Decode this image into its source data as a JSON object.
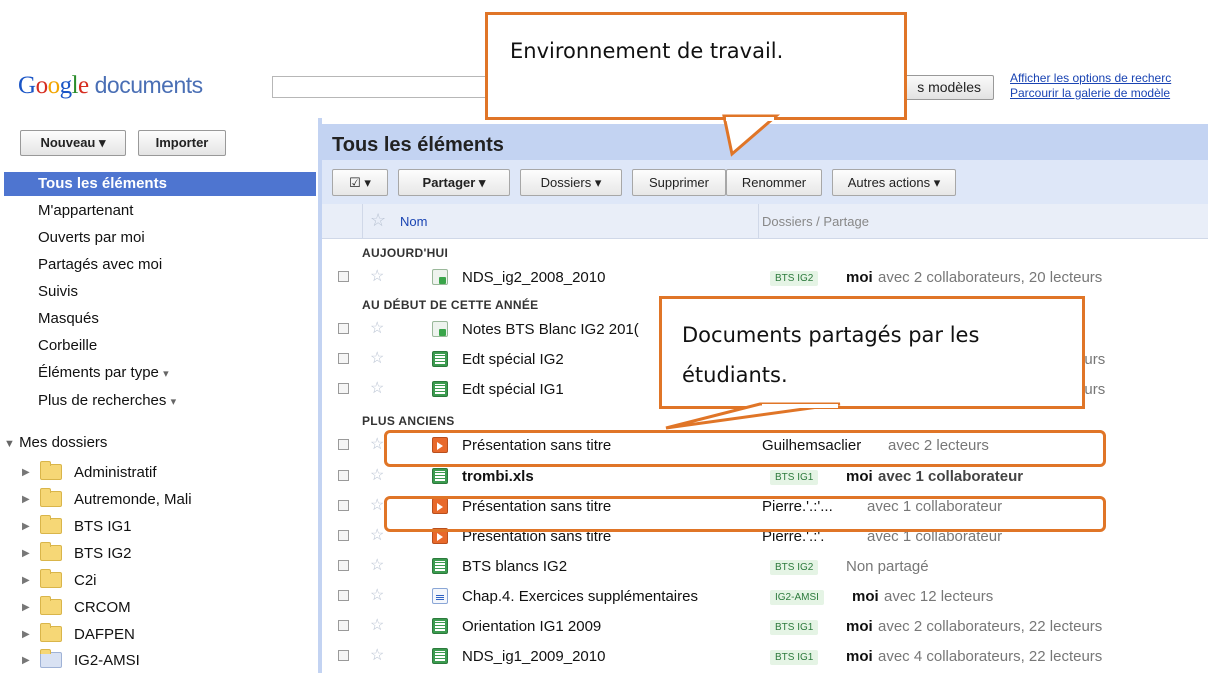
{
  "header": {
    "logo_letters": [
      "G",
      "o",
      "o",
      "g",
      "l",
      "e"
    ],
    "logo_word": "documents",
    "template_button": "s modèles",
    "link_search_options": "Afficher les options de recherc",
    "link_gallery": "Parcourir la galerie de modèle"
  },
  "sidebar": {
    "new_button": "Nouveau",
    "import_button": "Importer",
    "active_item": "Tous les éléments",
    "items": [
      "M'appartenant",
      "Ouverts par moi",
      "Partagés avec moi",
      "Suivis",
      "Masqués",
      "Corbeille",
      "Éléments par type",
      "Plus de recherches"
    ],
    "folders_title": "Mes dossiers",
    "folders": [
      "Administratif",
      "Autremonde, Mali",
      "BTS IG1",
      "BTS IG2",
      "C2i",
      "CRCOM",
      "DAFPEN",
      "IG2-AMSI"
    ]
  },
  "main": {
    "title": "Tous les éléments",
    "toolbar": [
      "Partager",
      "Dossiers",
      "Supprimer",
      "Renommer",
      "Autres actions"
    ],
    "col_name": "Nom",
    "col_share": "Dossiers / Partage"
  },
  "groups": [
    "AUJOURD'HUI",
    "AU DÉBUT DE CETTE ANNÉE",
    "PLUS ANCIENS"
  ],
  "rows": [
    {
      "name": "NDS_ig2_2008_2010",
      "tag": "BTS IG2",
      "owner": "moi",
      "detail": "avec 2 collaborateurs, 20 lecteurs"
    },
    {
      "name": "Notes BTS Blanc IG2 201(",
      "tag": "",
      "owner": "",
      "detail": ""
    },
    {
      "name": "Edt spécial IG2",
      "tag": "",
      "owner": "",
      "detail": "ecteurs"
    },
    {
      "name": "Edt spécial IG1",
      "tag": "",
      "owner": "",
      "detail": "ecteurs"
    },
    {
      "name": "Présentation sans titre",
      "tag": "",
      "owner": "Guilhemsaclier",
      "detail": "avec 2 lecteurs"
    },
    {
      "name": "trombi.xls",
      "tag": "BTS IG1",
      "owner": "moi",
      "detail": "avec 1 collaborateur"
    },
    {
      "name": "Présentation sans titre",
      "tag": "",
      "owner": "Pierre.'.:'...",
      "detail": "avec 1 collaborateur"
    },
    {
      "name": "Présentation sans titre",
      "tag": "",
      "owner": "Pierre.'.:'.",
      "detail": "avec 1 collaborateur"
    },
    {
      "name": "BTS blancs IG2",
      "tag": "BTS IG2",
      "owner": "",
      "detail": "Non partagé"
    },
    {
      "name": "Chap.4. Exercices supplémentaires",
      "tag": "IG2-AMSI",
      "owner": "moi",
      "detail": "avec 12 lecteurs"
    },
    {
      "name": "Orientation IG1 2009",
      "tag": "BTS IG1",
      "owner": "moi",
      "detail": "avec 2 collaborateurs, 22 lecteurs"
    },
    {
      "name": "NDS_ig1_2009_2010",
      "tag": "BTS IG1",
      "owner": "moi",
      "detail": "avec 4 collaborateurs, 22 lecteurs"
    }
  ],
  "callouts": {
    "env": "Environnement de travail.",
    "shared_line1": "Documents partagés par les",
    "shared_line2": "étudiants."
  },
  "colors": {
    "accent": "#4e75d0",
    "callout_border": "#e07527",
    "title_bar": "#c3d3f2"
  }
}
